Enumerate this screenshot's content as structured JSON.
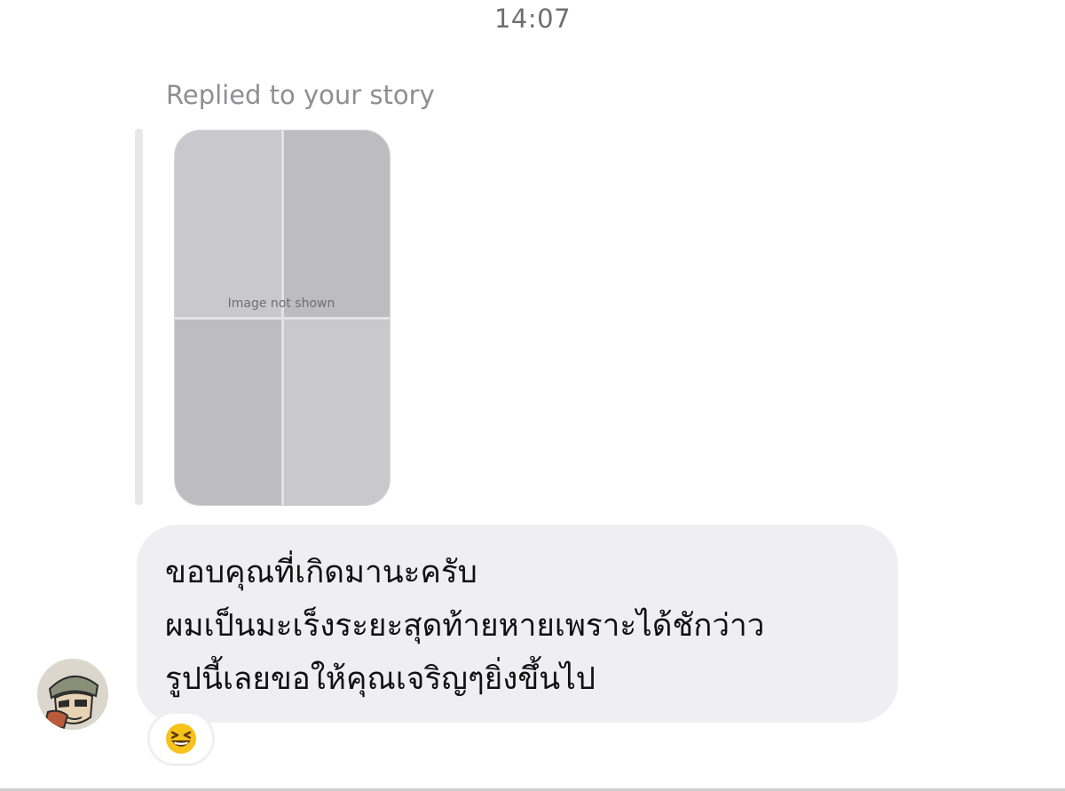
{
  "header": {
    "timestamp": "14:07"
  },
  "story_reply": {
    "label": "Replied to your story",
    "thumbnail_note": "Image not shown"
  },
  "message": {
    "lines": [
      "ขอบคุณที่เกิดมานะครับ",
      "ผมเป็นมะเร็งระยะสุดท้ายหายเพราะได้ชักว่าว",
      "รูปนี้เลยขอให้คุณเจริญๆยิ่งขึ้นไป"
    ]
  },
  "reaction": {
    "icon": "grinning-squinting-face-icon"
  },
  "colors": {
    "bubble": "#efeff1",
    "timestamp": "#6e6e73",
    "label": "#8e8e93",
    "reaction_face": "#f7c21a"
  }
}
